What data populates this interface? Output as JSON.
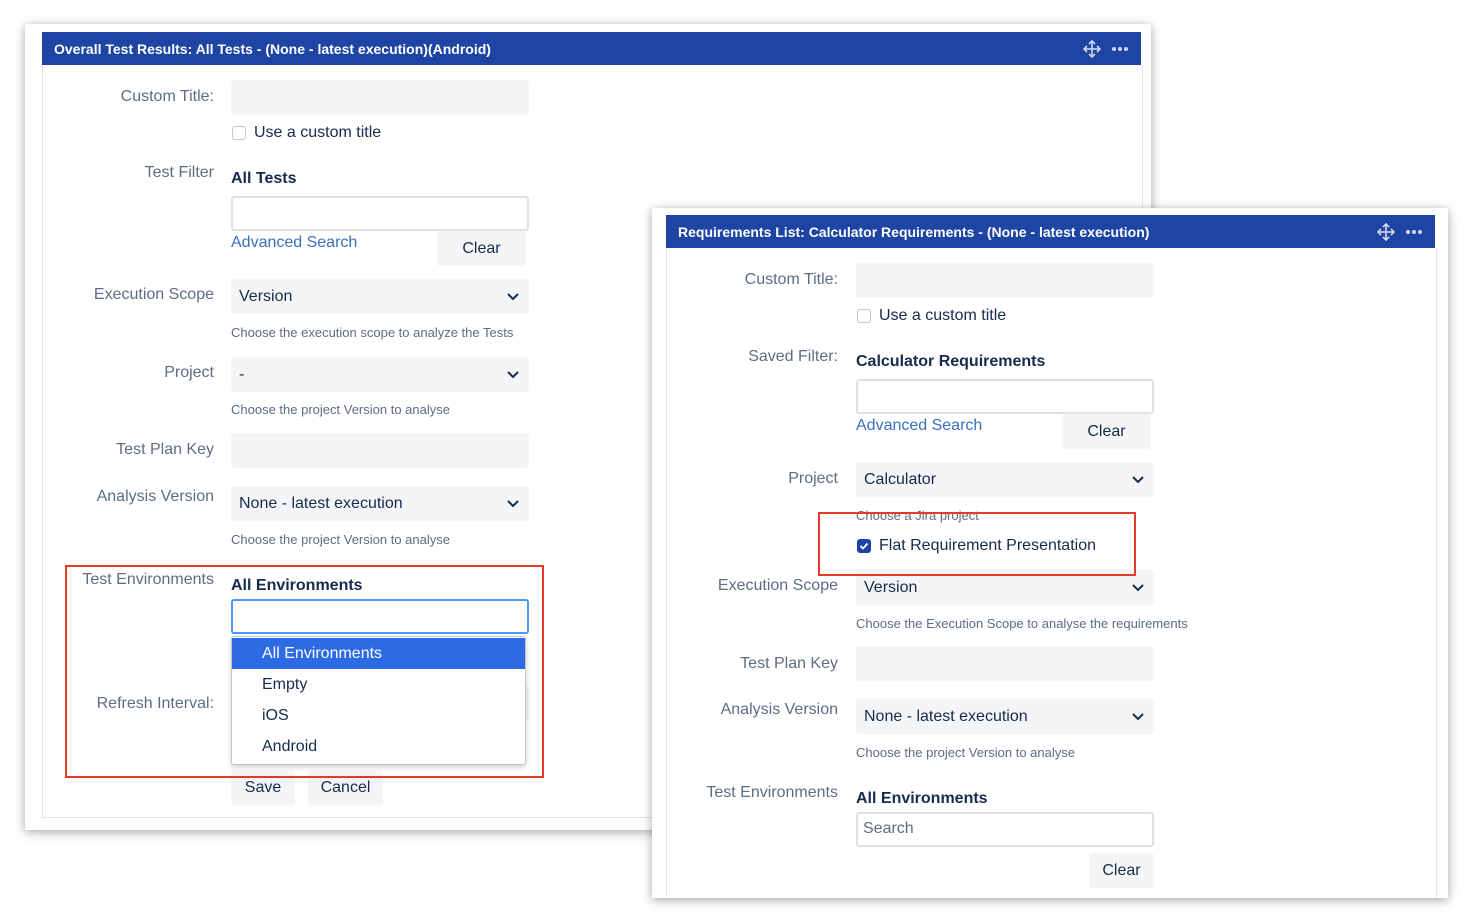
{
  "left_panel": {
    "title": "Overall Test Results: All Tests - (None - latest execution)(Android)",
    "custom_title_label": "Custom Title:",
    "use_custom_title_label": "Use a custom title",
    "test_filter_label": "Test Filter",
    "test_filter_value": "All Tests",
    "advanced_search": "Advanced Search",
    "clear": "Clear",
    "execution_scope_label": "Execution Scope",
    "execution_scope_value": "Version",
    "execution_scope_help": "Choose the execution scope to analyze the Tests",
    "project_label": "Project",
    "project_value": "-",
    "project_help": "Choose the project Version to analyse",
    "test_plan_key_label": "Test Plan Key",
    "analysis_version_label": "Analysis Version",
    "analysis_version_value": "None - latest execution",
    "analysis_version_help": "Choose the project Version to analyse",
    "test_environments_label": "Test Environments",
    "test_environments_value": "All Environments",
    "environment_options": [
      "All Environments",
      "Empty",
      "iOS",
      "Android"
    ],
    "refresh_interval_label": "Refresh Interval:",
    "save": "Save",
    "cancel": "Cancel"
  },
  "right_panel": {
    "title": "Requirements List: Calculator Requirements - (None - latest execution)",
    "custom_title_label": "Custom Title:",
    "use_custom_title_label": "Use a custom title",
    "saved_filter_label": "Saved Filter:",
    "saved_filter_value": "Calculator Requirements",
    "advanced_search": "Advanced Search",
    "clear": "Clear",
    "project_label": "Project",
    "project_value": "Calculator",
    "project_help": "Choose a Jira project",
    "flat_requirement_label": "Flat Requirement Presentation",
    "flat_requirement_checked": true,
    "execution_scope_label": "Execution Scope",
    "execution_scope_value": "Version",
    "execution_scope_help": "Choose the Execution Scope to analyse the requirements",
    "test_plan_key_label": "Test Plan Key",
    "analysis_version_label": "Analysis Version",
    "analysis_version_value": "None - latest execution",
    "analysis_version_help": "Choose the project Version to analyse",
    "test_environments_label": "Test Environments",
    "test_environments_value": "All Environments",
    "search_placeholder": "Search",
    "clear2": "Clear"
  },
  "colors": {
    "header": "#1e45a3",
    "link": "#3a6fbf",
    "highlight": "#e53a27",
    "selected_option": "#2d6be4"
  }
}
